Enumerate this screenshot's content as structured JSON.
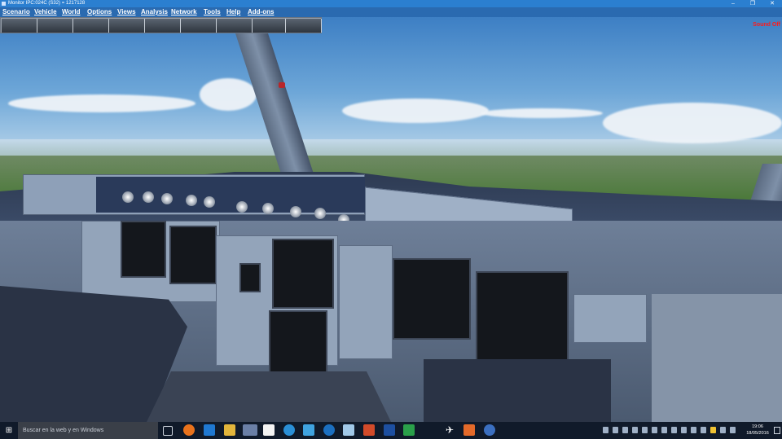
{
  "window": {
    "title": "Monitor IPC:024C (S32) = 1217128",
    "controls": [
      "–",
      "❐",
      "✕"
    ]
  },
  "menu": [
    "Scenario",
    "Vehicle",
    "World",
    "Options",
    "Views",
    "Analysis",
    "Network",
    "Tools",
    "Help",
    "Add-ons"
  ],
  "status": {
    "sound": "Sound Off"
  },
  "thumbnail_views": [
    "view-1",
    "view-2",
    "view-3",
    "view-4",
    "view-5",
    "view-6",
    "view-7",
    "view-8",
    "view-9"
  ],
  "taskbar": {
    "search_placeholder": "Buscar en la web y en Windows",
    "start_icon": "⊞",
    "apps": [
      "task-view-icon",
      "firefox-icon",
      "edge-icon",
      "file-explorer-icon",
      "prepar3d-icon",
      "notion-icon",
      "app-icon",
      "app-icon",
      "app-icon",
      "app-icon",
      "va-icon",
      "vatsim-icon",
      "xls-icon",
      "airplane-icon",
      "app-icon",
      "fsuipc-icon"
    ],
    "time": "19:06",
    "date": "18/05/2016"
  },
  "colors": {
    "accent": "#2b7fd0",
    "sound_off": "#ff1a1a"
  }
}
